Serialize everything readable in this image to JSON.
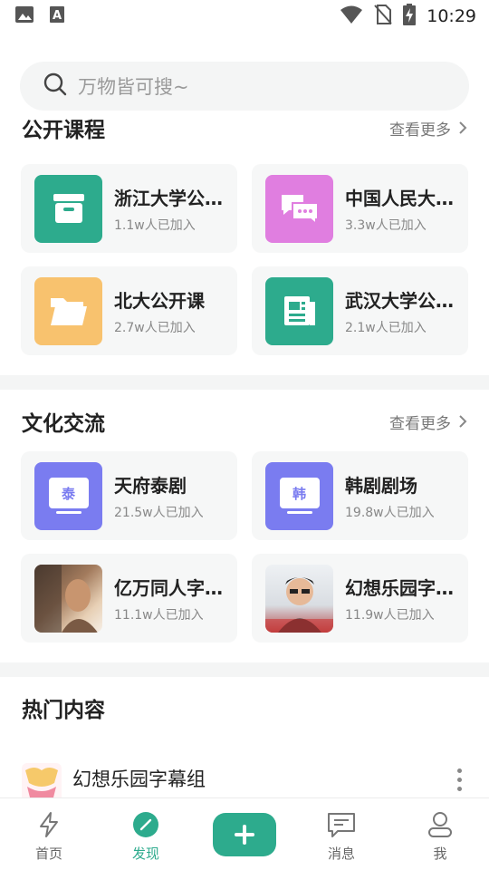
{
  "status_bar": {
    "time": "10:29",
    "left_icons": [
      "image-icon",
      "font-a-icon"
    ],
    "right_icons": [
      "wifi-icon",
      "no-sim-icon",
      "battery-charging-icon"
    ]
  },
  "search": {
    "placeholder": "万物皆可搜~"
  },
  "sections": {
    "open_courses": {
      "title": "公开课程",
      "more": "查看更多",
      "items": [
        {
          "title": "浙江大学公开课",
          "members": "1.1w人已加入",
          "icon": "archive-box-icon",
          "color": "#2dab8d"
        },
        {
          "title": "中国人民大学公开课",
          "members": "3.3w人已加入",
          "icon": "chat-bubbles-icon",
          "color": "#e07ee0"
        },
        {
          "title": "北大公开课",
          "members": "2.7w人已加入",
          "icon": "folder-icon",
          "color": "#f8c26e"
        },
        {
          "title": "武汉大学公开课",
          "members": "2.1w人已加入",
          "icon": "newspaper-icon",
          "color": "#2dab8d"
        }
      ]
    },
    "culture": {
      "title": "文化交流",
      "more": "查看更多",
      "items": [
        {
          "title": "天府泰剧",
          "members": "21.5w人已加入",
          "icon": "tv-icon",
          "badge": "泰",
          "color": "#7a7cf0"
        },
        {
          "title": "韩剧剧场",
          "members": "19.8w人已加入",
          "icon": "tv-icon",
          "badge": "韩",
          "color": "#7a7cf0"
        },
        {
          "title": "亿万同人字幕组",
          "members": "11.1w人已加入",
          "icon": "photo-thumbnail"
        },
        {
          "title": "幻想乐园字幕组",
          "members": "11.9w人已加入",
          "icon": "photo-thumbnail"
        }
      ]
    },
    "hot": {
      "title": "热门内容",
      "item_title": "幻想乐园字幕组"
    }
  },
  "bottom_nav": {
    "home": "首页",
    "discover": "发现",
    "messages": "消息",
    "me": "我",
    "accent": "#2dab8d"
  }
}
